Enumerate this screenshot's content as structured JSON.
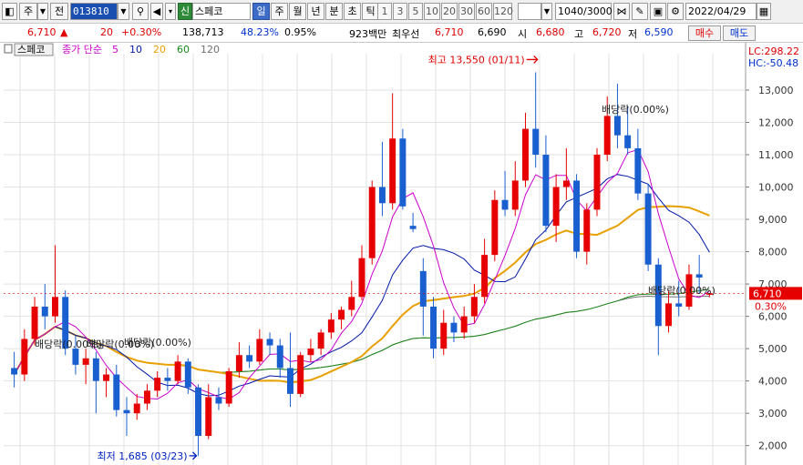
{
  "toolbar": {
    "market": "주",
    "scope": "전",
    "stock_code": "013810",
    "credit_tag": "신",
    "stock_name": "스페코",
    "periods": [
      "일",
      "주",
      "월",
      "년",
      "분",
      "초",
      "틱"
    ],
    "minutes": [
      "1",
      "3",
      "5",
      "10",
      "20",
      "30",
      "60",
      "120"
    ],
    "count": "1040/3000",
    "date": "2022/04/29"
  },
  "quote": {
    "price": "6,710",
    "arrow": "▲",
    "change": "20",
    "change_pct": "+0.30%",
    "volume": "138,713",
    "vol_ratio": "48.23%",
    "turnover": "0.95%",
    "amount": "923백만",
    "best_ask_label": "최우선",
    "best_ask": "6,710",
    "best_bid": "6,690",
    "open_label": "시",
    "open": "6,680",
    "high_label": "고",
    "high": "6,720",
    "low_label": "저",
    "low": "6,590",
    "buy_button": "매수",
    "sell_button": "매도"
  },
  "legend": {
    "name": "스페코",
    "ma_label": "종가 단순",
    "periods": [
      "5",
      "10",
      "20",
      "60",
      "120"
    ],
    "colors": [
      "#cc00cc",
      "#0018a8",
      "#e8a000",
      "#1a8a1a",
      "#707070"
    ]
  },
  "colors": {
    "up": "#e60000",
    "down": "#1a5fd0",
    "grid": "#e2e2e2",
    "price_tag": "#e60000"
  },
  "chart_data": {
    "type": "candlestick",
    "yticks": [
      2000,
      3000,
      4000,
      5000,
      6000,
      7000,
      8000,
      9000,
      10000,
      11000,
      12000,
      13000
    ],
    "ytick_labels": [
      "2,000",
      "3,000",
      "4,000",
      "5,000",
      "6,000",
      "7,000",
      "8,000",
      "9,000",
      "10,000",
      "11,000",
      "12,000",
      "13,000"
    ],
    "ylim": [
      1400,
      13900
    ],
    "lc": "LC:298.22",
    "hc": "HC:-50.48",
    "current_price": "6,710",
    "current_value": 6710,
    "current_pct": "0.30%",
    "max_label": "최고 13,550 (01/11)",
    "max_value": 13550,
    "min_label": "최저 1,685 (03/23)",
    "min_value": 1685,
    "dividend_labels": [
      "배당락(0.00%)",
      "배당락(0.00%)",
      "배당락(0.00%)",
      "배당락(0.00%)",
      "배당락(0.00%)"
    ],
    "candles": [
      {
        "o": 4400,
        "h": 4900,
        "l": 3800,
        "c": 4200
      },
      {
        "o": 4200,
        "h": 5600,
        "l": 4000,
        "c": 5300
      },
      {
        "o": 5300,
        "h": 6600,
        "l": 5100,
        "c": 6300
      },
      {
        "o": 6300,
        "h": 7000,
        "l": 5600,
        "c": 6000
      },
      {
        "o": 6000,
        "h": 8200,
        "l": 5800,
        "c": 6600
      },
      {
        "o": 6600,
        "h": 6800,
        "l": 4800,
        "c": 5000
      },
      {
        "o": 5000,
        "h": 5400,
        "l": 4200,
        "c": 4500
      },
      {
        "o": 4500,
        "h": 5000,
        "l": 3900,
        "c": 4700
      },
      {
        "o": 4700,
        "h": 4900,
        "l": 3000,
        "c": 4000
      },
      {
        "o": 4000,
        "h": 4400,
        "l": 3500,
        "c": 4200
      },
      {
        "o": 4200,
        "h": 4500,
        "l": 2900,
        "c": 3100
      },
      {
        "o": 3100,
        "h": 3500,
        "l": 2300,
        "c": 3000
      },
      {
        "o": 3000,
        "h": 3600,
        "l": 2800,
        "c": 3300
      },
      {
        "o": 3300,
        "h": 3900,
        "l": 3100,
        "c": 3700
      },
      {
        "o": 3700,
        "h": 4300,
        "l": 3500,
        "c": 4100
      },
      {
        "o": 4100,
        "h": 4400,
        "l": 3700,
        "c": 4000
      },
      {
        "o": 4000,
        "h": 4800,
        "l": 3900,
        "c": 4600
      },
      {
        "o": 4600,
        "h": 4700,
        "l": 3600,
        "c": 3800
      },
      {
        "o": 3800,
        "h": 3900,
        "l": 1685,
        "c": 2300
      },
      {
        "o": 2300,
        "h": 3900,
        "l": 2200,
        "c": 3500
      },
      {
        "o": 3500,
        "h": 3800,
        "l": 3100,
        "c": 3300
      },
      {
        "o": 3300,
        "h": 4400,
        "l": 3200,
        "c": 4300
      },
      {
        "o": 4300,
        "h": 5200,
        "l": 4100,
        "c": 4800
      },
      {
        "o": 4800,
        "h": 5100,
        "l": 4400,
        "c": 4600
      },
      {
        "o": 4600,
        "h": 5600,
        "l": 4500,
        "c": 5300
      },
      {
        "o": 5300,
        "h": 5500,
        "l": 4800,
        "c": 5100
      },
      {
        "o": 5100,
        "h": 5300,
        "l": 4100,
        "c": 4400
      },
      {
        "o": 4400,
        "h": 5500,
        "l": 3200,
        "c": 3600
      },
      {
        "o": 3600,
        "h": 4900,
        "l": 3500,
        "c": 4800
      },
      {
        "o": 4800,
        "h": 5300,
        "l": 4600,
        "c": 5000
      },
      {
        "o": 5000,
        "h": 5600,
        "l": 4800,
        "c": 5500
      },
      {
        "o": 5500,
        "h": 6100,
        "l": 5300,
        "c": 5900
      },
      {
        "o": 5900,
        "h": 6300,
        "l": 5600,
        "c": 6200
      },
      {
        "o": 6200,
        "h": 7100,
        "l": 6000,
        "c": 6600
      },
      {
        "o": 6600,
        "h": 8200,
        "l": 6500,
        "c": 7800
      },
      {
        "o": 7800,
        "h": 10200,
        "l": 7600,
        "c": 10000
      },
      {
        "o": 10000,
        "h": 11400,
        "l": 9100,
        "c": 9500
      },
      {
        "o": 9500,
        "h": 12900,
        "l": 9300,
        "c": 11500
      },
      {
        "o": 11500,
        "h": 11800,
        "l": 9300,
        "c": 9400
      },
      {
        "o": 8800,
        "h": 9200,
        "l": 8600,
        "c": 8700
      },
      {
        "o": 7400,
        "h": 7800,
        "l": 5400,
        "c": 6300
      },
      {
        "o": 6300,
        "h": 6600,
        "l": 4700,
        "c": 5000
      },
      {
        "o": 5000,
        "h": 6200,
        "l": 4800,
        "c": 5800
      },
      {
        "o": 5800,
        "h": 6000,
        "l": 5200,
        "c": 5500
      },
      {
        "o": 5500,
        "h": 6300,
        "l": 5300,
        "c": 6000
      },
      {
        "o": 6000,
        "h": 7000,
        "l": 5800,
        "c": 6600
      },
      {
        "o": 6600,
        "h": 8400,
        "l": 6400,
        "c": 7900
      },
      {
        "o": 7900,
        "h": 9900,
        "l": 7700,
        "c": 9600
      },
      {
        "o": 9600,
        "h": 10500,
        "l": 9100,
        "c": 9300
      },
      {
        "o": 9300,
        "h": 10800,
        "l": 9100,
        "c": 10200
      },
      {
        "o": 10200,
        "h": 12300,
        "l": 10000,
        "c": 11800
      },
      {
        "o": 11800,
        "h": 13550,
        "l": 10600,
        "c": 11000
      },
      {
        "o": 11000,
        "h": 11600,
        "l": 8600,
        "c": 8800
      },
      {
        "o": 8800,
        "h": 10400,
        "l": 8300,
        "c": 10000
      },
      {
        "o": 10000,
        "h": 11200,
        "l": 9600,
        "c": 10200
      },
      {
        "o": 10200,
        "h": 10400,
        "l": 7800,
        "c": 8000
      },
      {
        "o": 8000,
        "h": 9500,
        "l": 7600,
        "c": 9300
      },
      {
        "o": 9300,
        "h": 11200,
        "l": 9100,
        "c": 11000
      },
      {
        "o": 11000,
        "h": 12800,
        "l": 10800,
        "c": 12200
      },
      {
        "o": 12200,
        "h": 13200,
        "l": 11200,
        "c": 11600
      },
      {
        "o": 11600,
        "h": 12500,
        "l": 11000,
        "c": 11200
      },
      {
        "o": 11200,
        "h": 11800,
        "l": 9600,
        "c": 9800
      },
      {
        "o": 9800,
        "h": 10100,
        "l": 7400,
        "c": 7600
      },
      {
        "o": 7600,
        "h": 7800,
        "l": 4800,
        "c": 5700
      },
      {
        "o": 5700,
        "h": 6800,
        "l": 5500,
        "c": 6400
      },
      {
        "o": 6400,
        "h": 7100,
        "l": 6000,
        "c": 6300
      },
      {
        "o": 6300,
        "h": 7600,
        "l": 6200,
        "c": 7300
      },
      {
        "o": 7300,
        "h": 7900,
        "l": 6700,
        "c": 7200
      },
      {
        "o": 6690,
        "h": 6720,
        "l": 6590,
        "c": 6710
      }
    ]
  }
}
